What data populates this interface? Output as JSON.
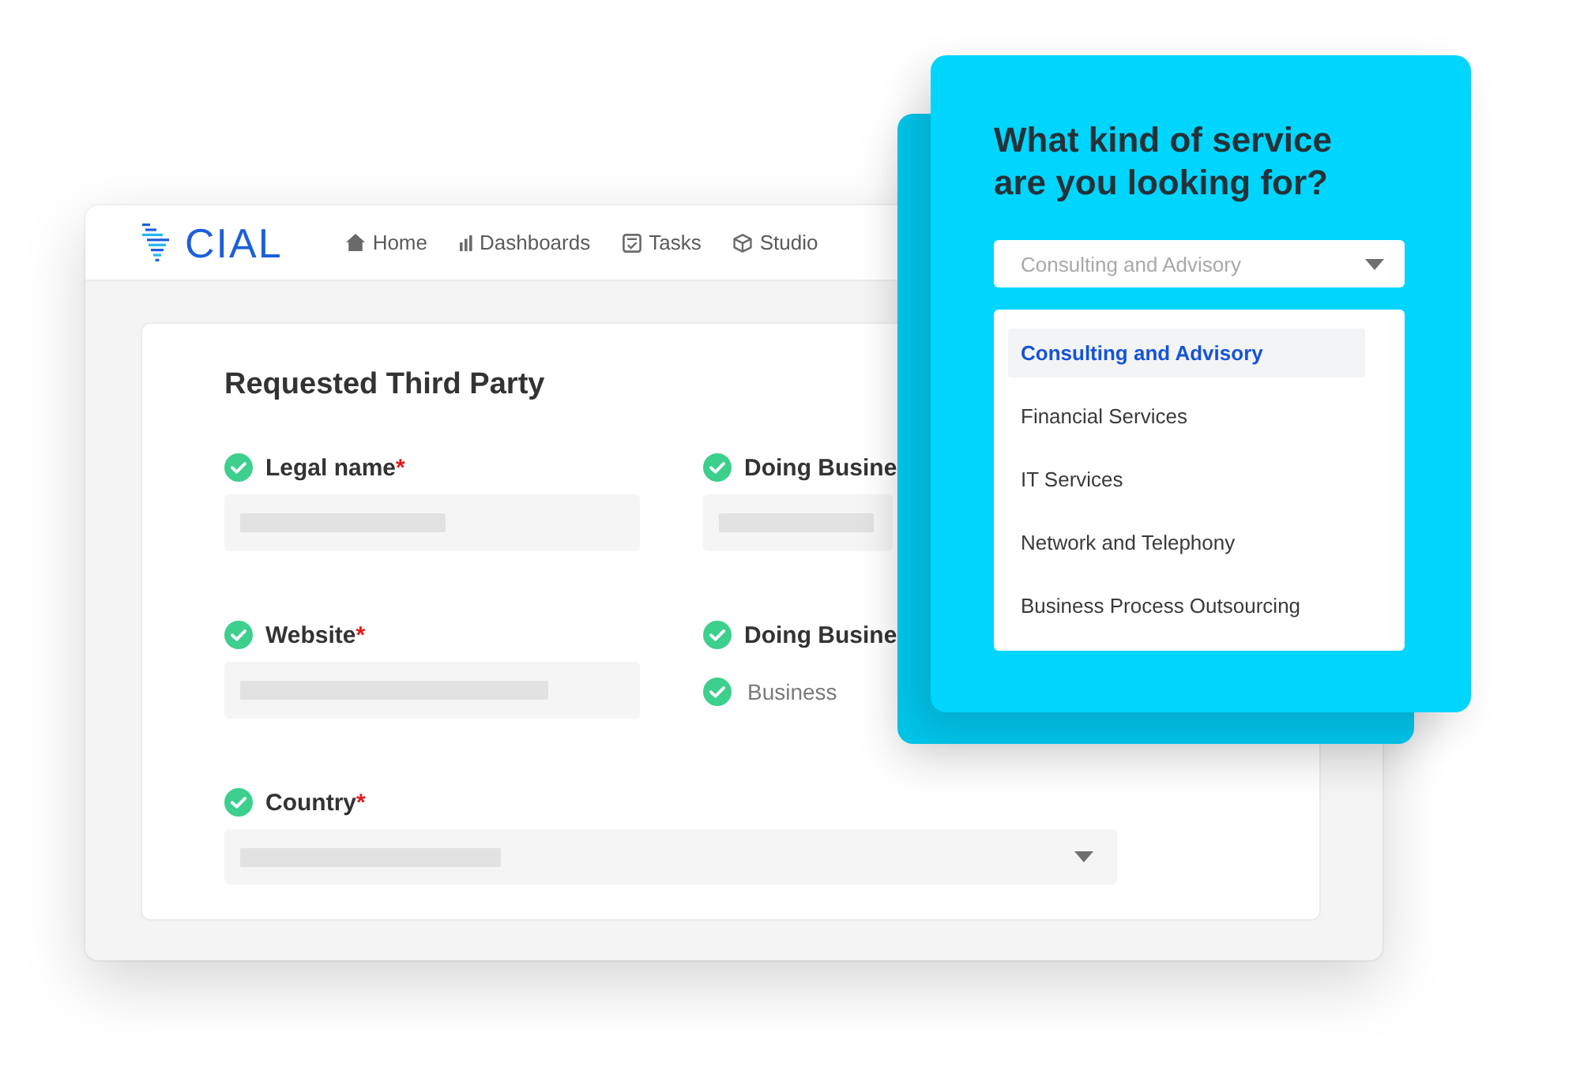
{
  "app_window": {
    "logo": {
      "text": "CIAL"
    },
    "nav": [
      {
        "label": "Home"
      },
      {
        "label": "Dashboards"
      },
      {
        "label": "Tasks"
      },
      {
        "label": "Studio"
      }
    ],
    "form": {
      "title": "Requested Third Party",
      "fields": [
        {
          "kind": "text",
          "label": "Legal name",
          "required_mark": "*",
          "verified": true,
          "redacted": true
        },
        {
          "kind": "text",
          "label": "Doing Busine",
          "verified": true,
          "redacted": true
        },
        {
          "kind": "text",
          "label": "Website",
          "required_mark": "*",
          "verified": true,
          "redacted": true
        },
        {
          "kind": "checklist",
          "label": "Doing Busine",
          "verified": true,
          "options": [
            {
              "label": "Business",
              "checked": true
            }
          ]
        },
        {
          "kind": "select",
          "label": "Country",
          "required_mark": "*",
          "verified": true,
          "redacted": true
        }
      ]
    }
  },
  "service_popup": {
    "title": "What kind of service are you looking for?",
    "dropdown": {
      "placeholder": "Consulting and Advisory"
    },
    "options": [
      {
        "label": "Consulting and Advisory",
        "selected": true
      },
      {
        "label": "Financial Services",
        "selected": false
      },
      {
        "label": "IT Services",
        "selected": false
      },
      {
        "label": "Network and Telephony",
        "selected": false
      },
      {
        "label": "Business Process Outsourcing",
        "selected": false
      }
    ]
  }
}
